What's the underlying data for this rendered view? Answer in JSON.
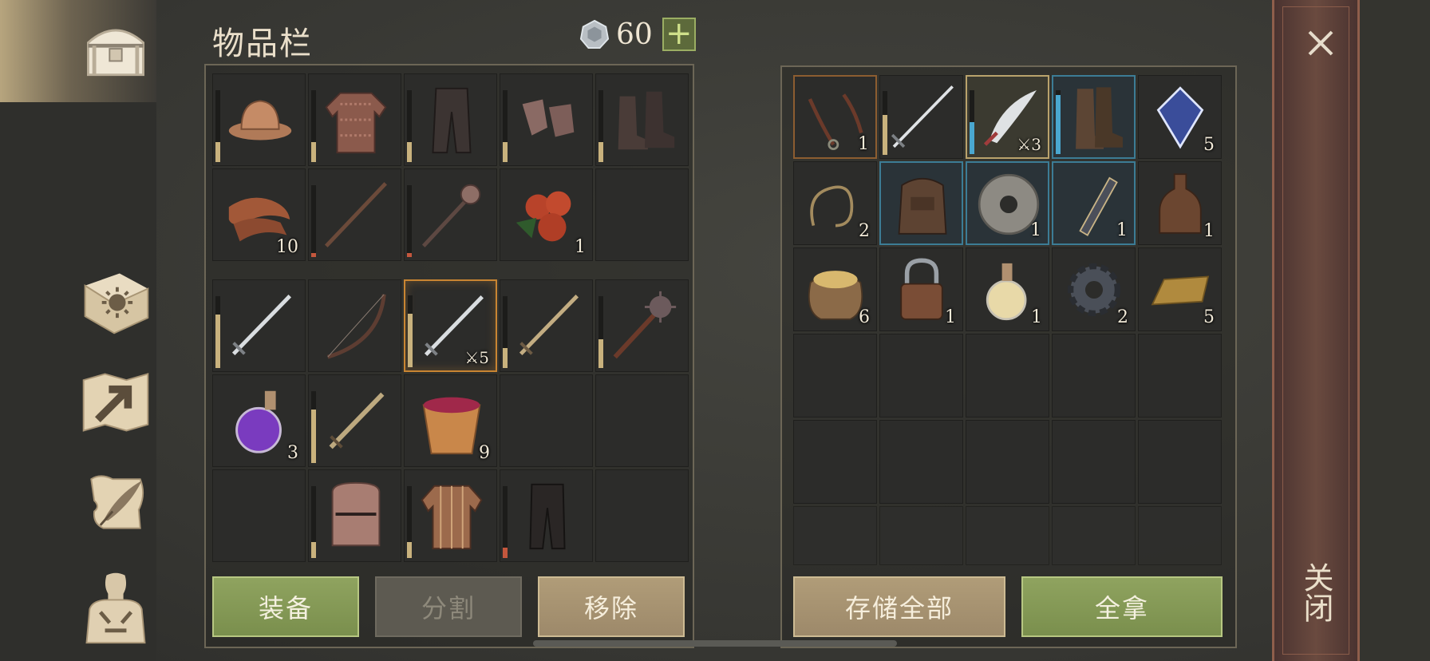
{
  "header": {
    "title": "物品栏",
    "currency": "60",
    "plus": "+"
  },
  "nav": {
    "items": [
      "chest-icon",
      "sun-book-icon",
      "map-arrow-icon",
      "scroll-quill-icon",
      "character-icon"
    ]
  },
  "inventory": {
    "equipment": [
      {
        "icon": "leather-hat",
        "dur": 0.28,
        "qty": ""
      },
      {
        "icon": "chainmail-shirt",
        "dur": 0.28,
        "qty": ""
      },
      {
        "icon": "dark-trousers",
        "dur": 0.28,
        "qty": ""
      },
      {
        "icon": "chain-gloves",
        "dur": 0.28,
        "qty": ""
      },
      {
        "icon": "leather-boots",
        "dur": 0.28,
        "qty": ""
      },
      {
        "icon": "bacon",
        "dur": null,
        "qty": "10"
      },
      {
        "icon": "wooden-staff",
        "dur": 0.06,
        "red": true,
        "qty": ""
      },
      {
        "icon": "flanged-mace",
        "dur": 0.06,
        "red": true,
        "qty": ""
      },
      {
        "icon": "berries",
        "dur": null,
        "qty": "1"
      },
      {
        "icon": "",
        "dur": null,
        "qty": ""
      }
    ],
    "items": [
      {
        "icon": "sword",
        "dur": 0.75,
        "qty": "",
        "cls": ""
      },
      {
        "icon": "bow",
        "dur": null,
        "qty": "",
        "cls": ""
      },
      {
        "icon": "sword",
        "dur": 0.75,
        "qty": "⚔5",
        "cls": "selected-orange",
        "dart": true
      },
      {
        "icon": "bronze-sword",
        "dur": 0.28,
        "qty": "",
        "cls": ""
      },
      {
        "icon": "spiked-mace",
        "dur": 0.4,
        "qty": "",
        "cls": ""
      },
      {
        "icon": "purple-potion",
        "dur": null,
        "qty": "3",
        "cls": ""
      },
      {
        "icon": "short-sword",
        "dur": 0.75,
        "qty": "",
        "cls": ""
      },
      {
        "icon": "berry-bucket",
        "dur": null,
        "qty": "9",
        "cls": ""
      },
      {
        "icon": "",
        "dur": null,
        "qty": "",
        "cls": ""
      },
      {
        "icon": "",
        "dur": null,
        "qty": "",
        "cls": ""
      },
      {
        "icon": "",
        "dur": null,
        "qty": "",
        "cls": ""
      },
      {
        "icon": "great-helm",
        "dur": 0.22,
        "qty": "",
        "cls": ""
      },
      {
        "icon": "padded-gambeson",
        "dur": 0.22,
        "qty": "",
        "cls": ""
      },
      {
        "icon": "black-leggings",
        "dur": 0.14,
        "red": true,
        "qty": "",
        "cls": ""
      },
      {
        "icon": "",
        "dur": null,
        "qty": "",
        "cls": ""
      }
    ]
  },
  "storage": {
    "items": [
      {
        "icon": "harness",
        "qty": "1",
        "cls": "frame-orange"
      },
      {
        "icon": "long-sword",
        "qty": "",
        "cls": "",
        "dur": 0.62
      },
      {
        "icon": "scimitar",
        "qty": "⚔3",
        "cls": "frame-gold",
        "dur": 0.5,
        "blue": true,
        "dart": true
      },
      {
        "icon": "tall-boots",
        "qty": "",
        "cls": "frame-blue",
        "dur": 0.92,
        "blue": true
      },
      {
        "icon": "crystal",
        "qty": "5",
        "cls": ""
      },
      {
        "icon": "rope",
        "qty": "2",
        "cls": ""
      },
      {
        "icon": "backpack",
        "qty": "",
        "cls": "frame-blue"
      },
      {
        "icon": "millstone",
        "qty": "1",
        "cls": "frame-blue"
      },
      {
        "icon": "ornate-hilt",
        "qty": "1",
        "cls": "frame-blue"
      },
      {
        "icon": "bottle",
        "qty": "1",
        "cls": ""
      },
      {
        "icon": "grain-sack",
        "qty": "6",
        "cls": ""
      },
      {
        "icon": "padlock",
        "qty": "1",
        "cls": ""
      },
      {
        "icon": "light-potion",
        "qty": "1",
        "cls": ""
      },
      {
        "icon": "gear",
        "qty": "2",
        "cls": ""
      },
      {
        "icon": "gold-ingot",
        "qty": "5",
        "cls": ""
      }
    ]
  },
  "buttons": {
    "equip": "装备",
    "split": "分割",
    "remove": "移除",
    "store_all": "存储全部",
    "take_all": "全拿",
    "close": "关闭"
  }
}
